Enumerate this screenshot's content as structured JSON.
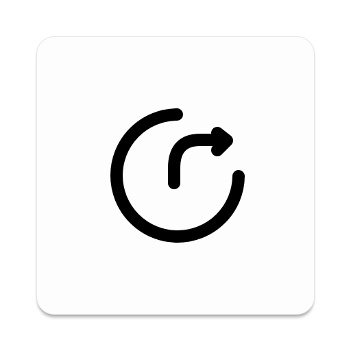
{
  "app_icon": {
    "icon": "redo-rotate-icon",
    "tile_color": "#fdfdfd",
    "glyph_color": "#000000"
  }
}
